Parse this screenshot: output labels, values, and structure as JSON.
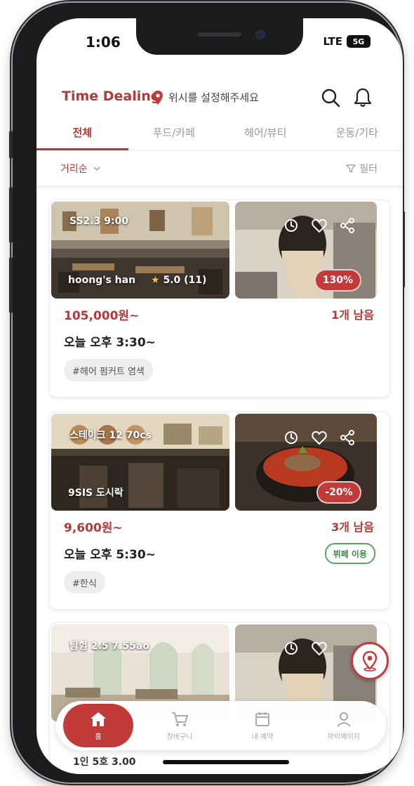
{
  "status": {
    "time": "1:06",
    "network": "LTE",
    "battery": "5G"
  },
  "header": {
    "brand": "Time Dealing",
    "location": "위시를 설정해주세요"
  },
  "tabs": [
    {
      "label": "전체"
    },
    {
      "label": "푸드/카페"
    },
    {
      "label": "헤어/뷰티"
    },
    {
      "label": "운동/기타"
    }
  ],
  "filters": {
    "sort": "거리순",
    "filter": "필터"
  },
  "deals": [
    {
      "overlay_top": "SS2.3 9:00",
      "overlay_bottom": "hoong's han",
      "rating": "5.0 (11)",
      "discount": "130%",
      "price": "105,000원~",
      "remaining": "1개 남음",
      "time": "오늘 오후 3:30~",
      "tag": "#헤어 펌커트 염색"
    },
    {
      "overlay_top": "스테이크 12 70cs",
      "overlay_bottom": "9SIS 도시락",
      "discount": "-20%",
      "price": "9,600원~",
      "remaining": "3개 남음",
      "time": "오늘 오후 5:30~",
      "tag": "#한식",
      "badge": "뷔페 이용"
    },
    {
      "overlay_top": "탐험 2.5 7.55ao",
      "overlay_bottom": "",
      "below_nav_text": "1인 5호 3.00"
    }
  ],
  "nav": [
    {
      "label": "홈",
      "icon": "home-icon"
    },
    {
      "label": "장바구니",
      "icon": "cart-icon"
    },
    {
      "label": "내 예약",
      "icon": "calendar-icon"
    },
    {
      "label": "마이페이지",
      "icon": "user-icon"
    }
  ],
  "colors": {
    "accent": "#b33a3a",
    "badge_green": "#3d8a48"
  }
}
